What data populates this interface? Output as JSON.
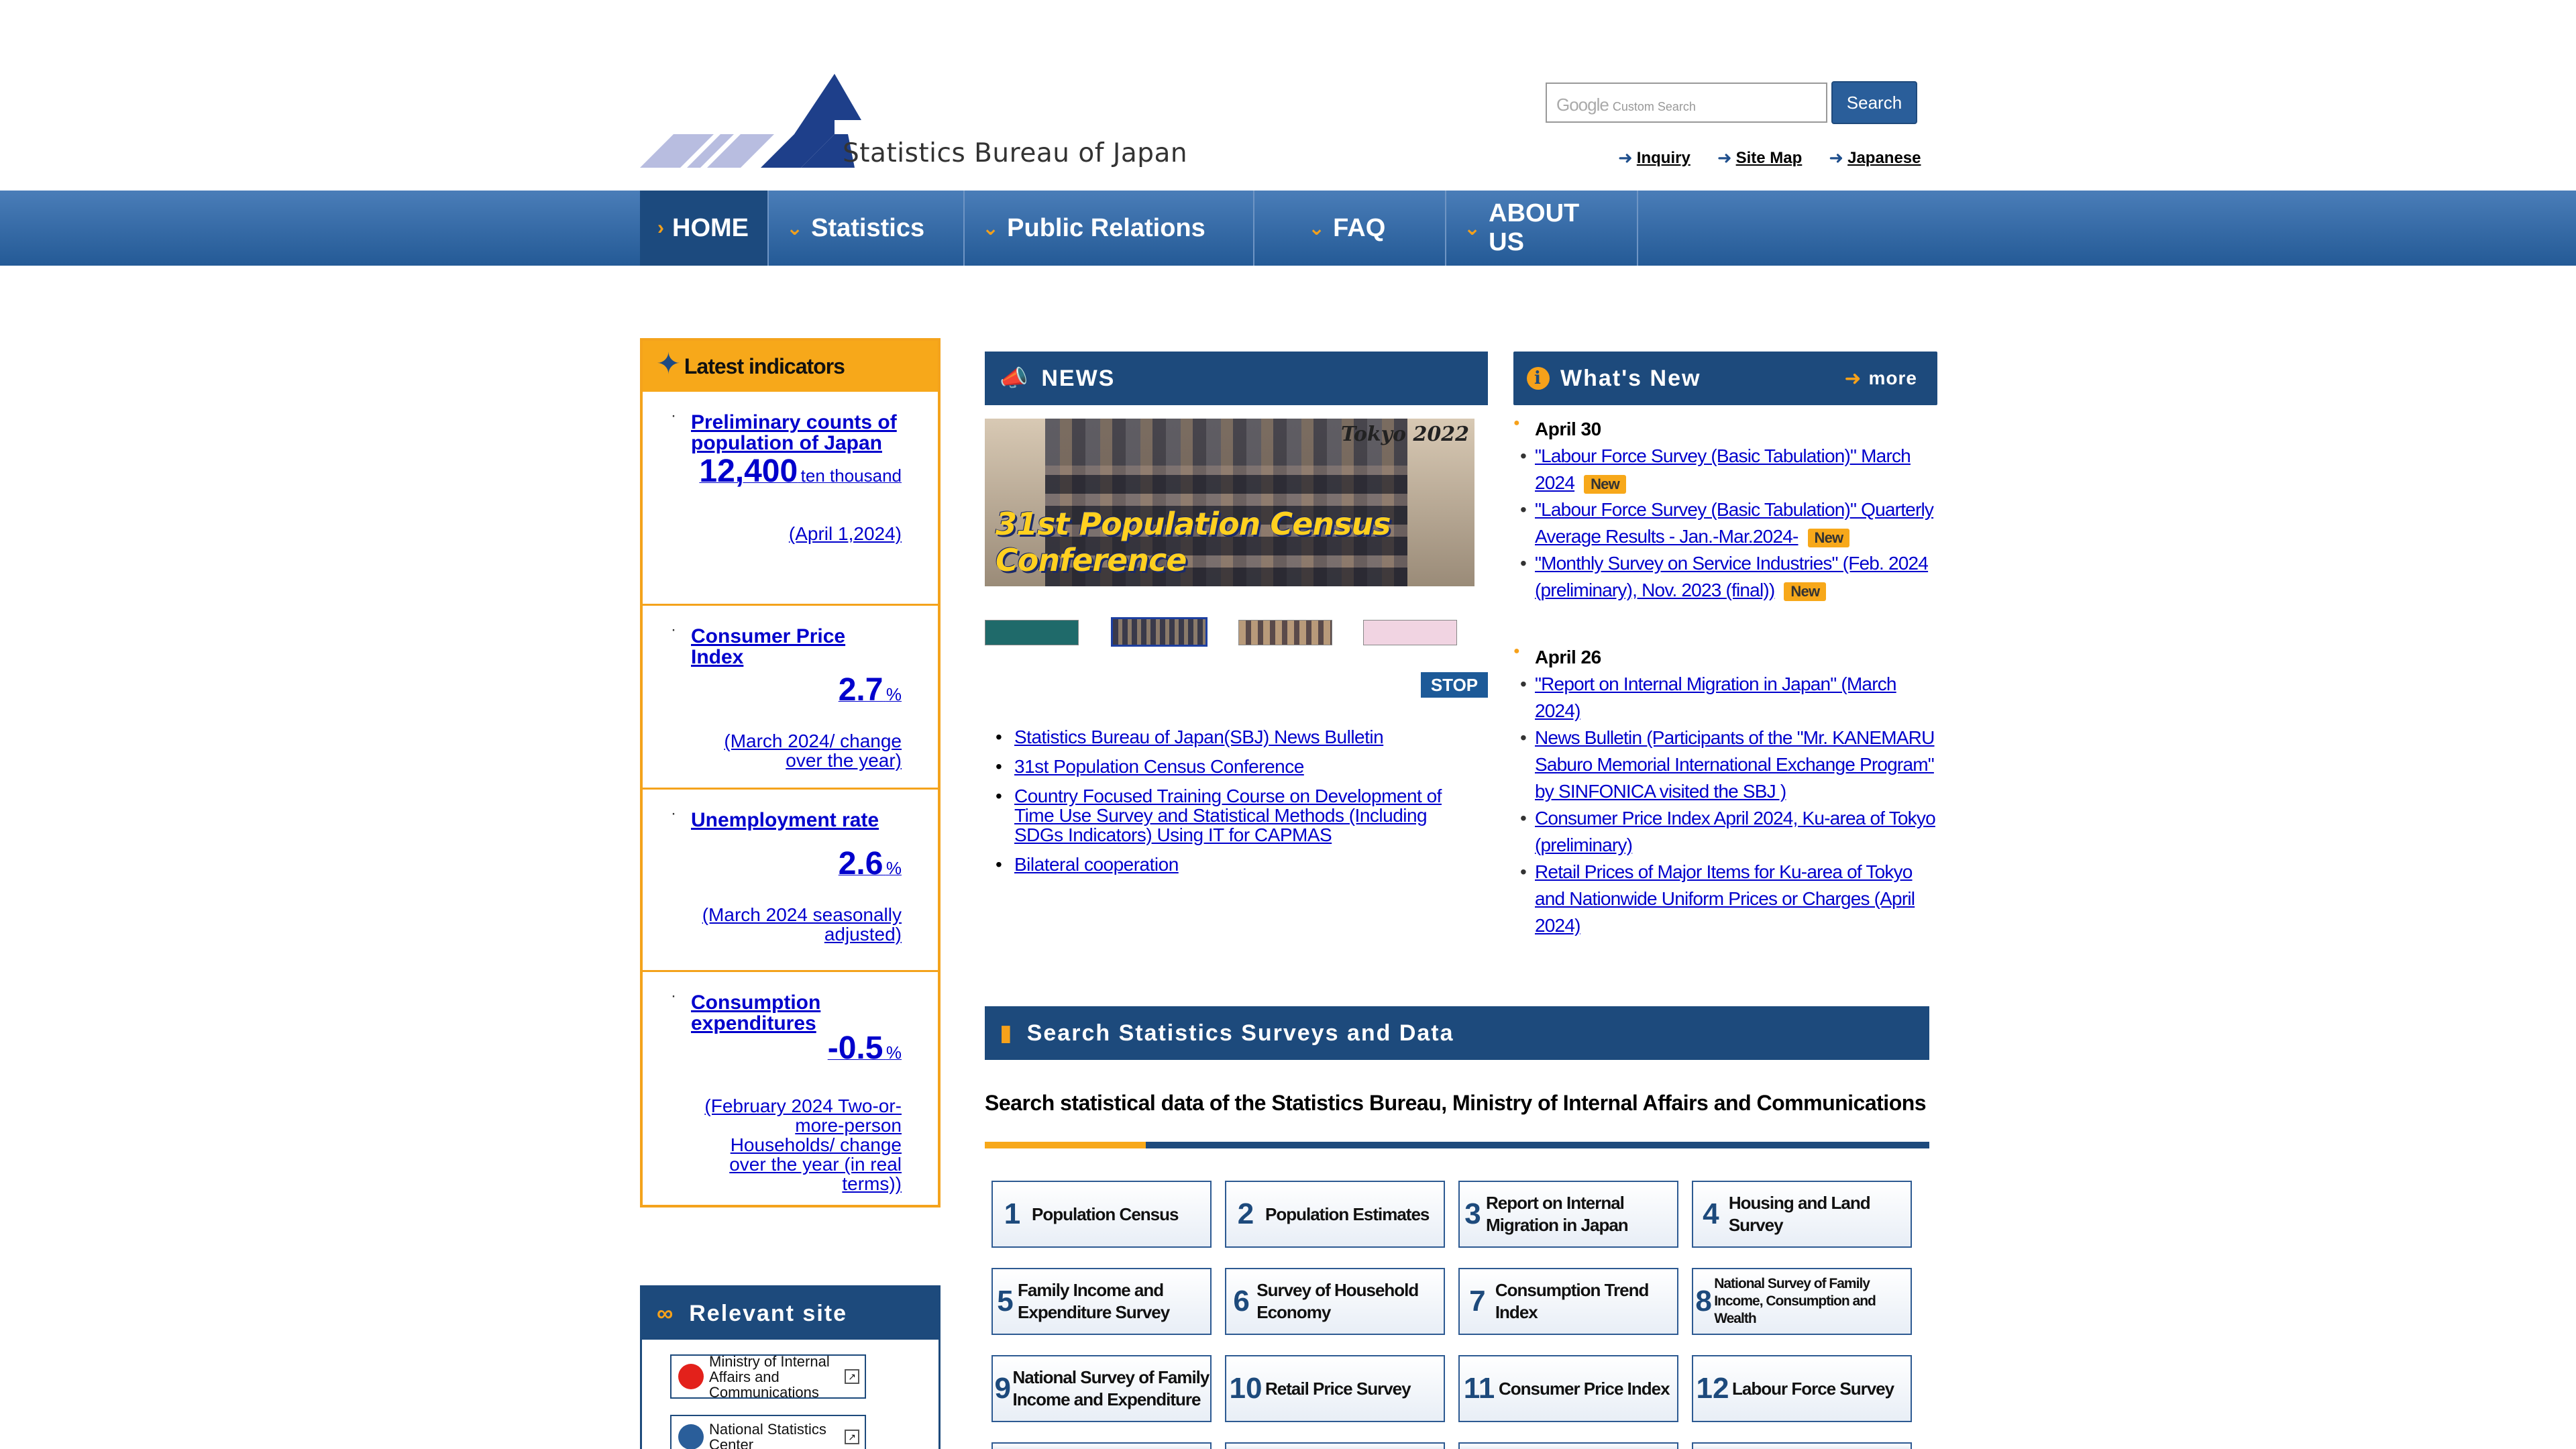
{
  "header": {
    "site_title": "Statistics Bureau of Japan",
    "search_placeholder_brand": "Google",
    "search_placeholder": "Custom Search",
    "search_button": "Search",
    "links": [
      {
        "label": "Inquiry"
      },
      {
        "label": "Site Map"
      },
      {
        "label": "Japanese"
      }
    ]
  },
  "nav": {
    "items": [
      {
        "label": "HOME",
        "marker": "›"
      },
      {
        "label": "Statistics",
        "marker": "⌄"
      },
      {
        "label": "Public Relations",
        "marker": "⌄"
      },
      {
        "label": "FAQ",
        "marker": "⌄"
      },
      {
        "label": "ABOUT US",
        "marker": "⌄"
      }
    ]
  },
  "indicators": {
    "title": "Latest indicators",
    "items": [
      {
        "title": "Preliminary counts of population of Japan",
        "value": "12,400",
        "unit": "ten thousand",
        "date": "(April 1,2024)"
      },
      {
        "title": "Consumer Price Index",
        "value": "2.7",
        "unit": "%",
        "date": "(March 2024/ change over the year)"
      },
      {
        "title": "Unemployment rate",
        "value": "2.6",
        "unit": "%",
        "date": "(March 2024 seasonally adjusted)"
      },
      {
        "title": "Consumption expenditures",
        "value": "-0.5",
        "unit": "%",
        "date": "(February 2024 Two-or-more-person Households/ change over the year (in real terms))"
      }
    ]
  },
  "relevant": {
    "title": "Relevant site",
    "links": [
      {
        "label": "Ministry of Internal Affairs and Communications"
      },
      {
        "label": "National Statistics Center"
      }
    ]
  },
  "news": {
    "title": "NEWS",
    "banner_year": "Tokyo 2022",
    "banner_caption": "31st Population Census Conference",
    "stop_label": "STOP",
    "items": [
      "Statistics Bureau of Japan(SBJ) News Bulletin",
      "31st Population Census Conference",
      "Country Focused Training Course on Development of Time Use Survey and Statistical Methods (Including SDGs Indicators) Using IT for CAPMAS",
      "Bilateral cooperation"
    ]
  },
  "whats_new": {
    "title": "What's New",
    "more": "more",
    "new_label": "New",
    "groups": [
      {
        "date": "April 30",
        "items": [
          {
            "text": "\"Labour Force Survey (Basic Tabulation)\" March 2024",
            "new": true
          },
          {
            "text": "\"Labour Force Survey (Basic Tabulation)\" Quarterly Average Results - Jan.-Mar.2024-",
            "new": true
          },
          {
            "text": "\"Monthly Survey on Service Industries\" (Feb. 2024 (preliminary), Nov. 2023 (final))",
            "new": true
          }
        ]
      },
      {
        "date": "April 26",
        "items": [
          {
            "text": "\"Report on Internal Migration in Japan\" (March 2024)",
            "new": false
          },
          {
            "text": "News Bulletin (Participants of the \"Mr. KANEMARU Saburo Memorial International Exchange Program\" by SINFONICA visited the SBJ )",
            "new": false
          },
          {
            "text": "Consumer Price Index April 2024, Ku-area of Tokyo (preliminary)",
            "new": false
          },
          {
            "text": "Retail Prices of Major Items for Ku-area of Tokyo and Nationwide Uniform Prices or Charges (April 2024)",
            "new": false
          }
        ]
      }
    ]
  },
  "search_stats": {
    "title": "Search Statistics Surveys and Data",
    "subtitle": "Search statistical data of the Statistics Bureau, Ministry of Internal Affairs and Communications",
    "surveys": [
      {
        "num": "1",
        "label": "Population Census"
      },
      {
        "num": "2",
        "label": "Population Estimates"
      },
      {
        "num": "3",
        "label": "Report on Internal Migration in Japan"
      },
      {
        "num": "4",
        "label": "Housing and Land Survey"
      },
      {
        "num": "5",
        "label": "Family Income and Expenditure Survey"
      },
      {
        "num": "6",
        "label": "Survey of Household Economy"
      },
      {
        "num": "7",
        "label": "Consumption Trend Index"
      },
      {
        "num": "8",
        "label": "National Survey of Family Income, Consumption and Wealth"
      },
      {
        "num": "9",
        "label": "National Survey of Family Income and Expenditure"
      },
      {
        "num": "10",
        "label": "Retail Price Survey"
      },
      {
        "num": "11",
        "label": "Consumer Price Index"
      },
      {
        "num": "12",
        "label": "Labour Force Survey"
      }
    ]
  }
}
